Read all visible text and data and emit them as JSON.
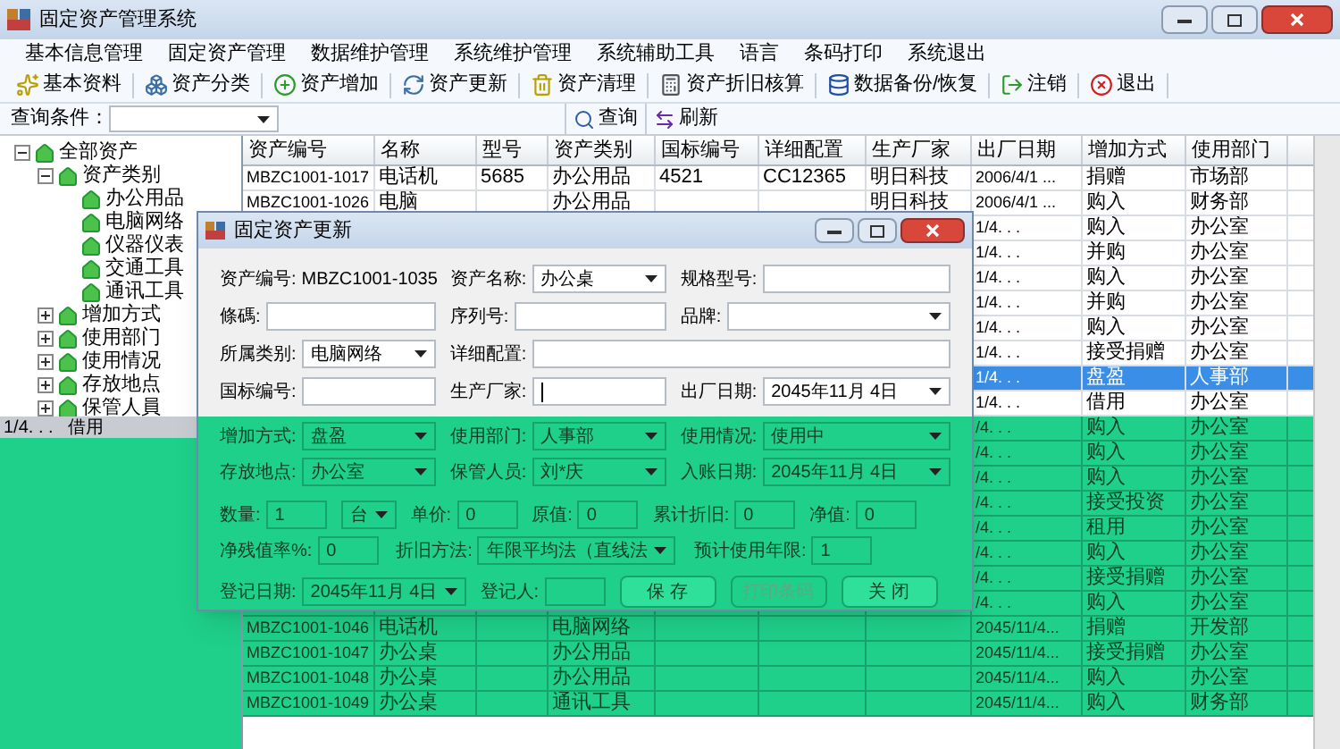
{
  "window": {
    "title": "固定资产管理系统"
  },
  "menu": [
    "基本信息管理",
    "固定资产管理",
    "数据维护管理",
    "系统维护管理",
    "系统辅助工具",
    "语言",
    "条码打印",
    "系统退出"
  ],
  "toolbar": [
    "基本资料",
    "资产分类",
    "资产增加",
    "资产更新",
    "资产清理",
    "资产折旧核算",
    "数据备份/恢复",
    "注销",
    "退出"
  ],
  "query": {
    "label": "查询条件：",
    "buttons": [
      "查询",
      "刷新"
    ]
  },
  "tree": [
    {
      "label": "全部资产",
      "expanded": true,
      "children": [
        {
          "label": "资产类别",
          "expanded": true,
          "children": [
            {
              "label": "办公用品"
            },
            {
              "label": "电脑网络"
            },
            {
              "label": "仪器仪表"
            },
            {
              "label": "交通工具"
            },
            {
              "label": "通讯工具"
            }
          ]
        },
        {
          "label": "增加方式",
          "expanded": false
        },
        {
          "label": "使用部门",
          "expanded": false
        },
        {
          "label": "使用情况",
          "expanded": false
        },
        {
          "label": "存放地点",
          "expanded": false
        },
        {
          "label": "保管人員",
          "expanded": false
        }
      ]
    }
  ],
  "glitch_strip": [
    "1/4. . .",
    "借用"
  ],
  "table": {
    "columns": [
      "资产编号",
      "名称",
      "型号",
      "资产类别",
      "国标编号",
      "详细配置",
      "生产厂家",
      "出厂日期",
      "增加方式",
      "使用部门"
    ],
    "rows": [
      {
        "selected": false,
        "cells": [
          "MBZC1001-1017",
          "电话机",
          "5685",
          "办公用品",
          "4521",
          "CC12365",
          "明日科技",
          "2006/4/1 ...",
          "捐赠",
          "市场部"
        ]
      },
      {
        "selected": false,
        "cells": [
          "MBZC1001-1026",
          "电脑",
          null,
          "办公用品",
          null,
          null,
          "明日科技",
          "2006/4/1 ...",
          "购入",
          "财务部"
        ]
      },
      {
        "selected": false,
        "cells": [
          null,
          null,
          null,
          null,
          null,
          null,
          null,
          "1/4. . .",
          "购入",
          "办公室"
        ]
      },
      {
        "selected": false,
        "cells": [
          null,
          null,
          null,
          null,
          null,
          null,
          null,
          "1/4. . .",
          "并购",
          "办公室"
        ]
      },
      {
        "selected": false,
        "cells": [
          null,
          null,
          null,
          null,
          null,
          null,
          null,
          "1/4. . .",
          "购入",
          "办公室"
        ]
      },
      {
        "selected": false,
        "cells": [
          null,
          null,
          null,
          null,
          null,
          null,
          null,
          "1/4. . .",
          "并购",
          "办公室"
        ]
      },
      {
        "selected": false,
        "cells": [
          null,
          null,
          null,
          null,
          null,
          null,
          null,
          "1/4. . .",
          "购入",
          "办公室"
        ]
      },
      {
        "selected": false,
        "cells": [
          null,
          null,
          null,
          null,
          null,
          null,
          null,
          "1/4. . .",
          "接受捐赠",
          "办公室"
        ]
      },
      {
        "selected": true,
        "cells": [
          null,
          null,
          null,
          null,
          null,
          null,
          null,
          "1/4. . .",
          "盘盈",
          "人事部"
        ]
      },
      {
        "selected": false,
        "cells": [
          null,
          null,
          null,
          null,
          null,
          null,
          null,
          "1/4. . .",
          "借用",
          "办公室"
        ]
      },
      {
        "selected": false,
        "cells": [
          null,
          null,
          null,
          null,
          null,
          null,
          null,
          "/4. . .",
          "购入",
          "办公室"
        ]
      },
      {
        "selected": false,
        "cells": [
          null,
          null,
          null,
          null,
          null,
          null,
          null,
          "/4. . .",
          "购入",
          "办公室"
        ]
      },
      {
        "selected": false,
        "cells": [
          null,
          null,
          null,
          null,
          null,
          null,
          null,
          "/4. . .",
          "购入",
          "办公室"
        ]
      },
      {
        "selected": false,
        "cells": [
          null,
          null,
          null,
          null,
          null,
          null,
          null,
          "/4. . .",
          "接受投资",
          "办公室"
        ]
      },
      {
        "selected": false,
        "cells": [
          null,
          null,
          null,
          null,
          null,
          null,
          null,
          "/4. . .",
          "租用",
          "办公室"
        ]
      },
      {
        "selected": false,
        "cells": [
          null,
          null,
          null,
          null,
          null,
          null,
          null,
          "/4. . .",
          "购入",
          "办公室"
        ]
      },
      {
        "selected": false,
        "cells": [
          null,
          null,
          null,
          null,
          null,
          null,
          null,
          "/4. . .",
          "接受捐赠",
          "办公室"
        ]
      },
      {
        "selected": false,
        "cells": [
          null,
          null,
          null,
          null,
          null,
          null,
          null,
          "/4. . .",
          "购入",
          "办公室"
        ]
      },
      {
        "selected": false,
        "cells": [
          "MBZC1001-1046",
          "电话机",
          null,
          "电脑网络",
          null,
          null,
          null,
          "2045/11/4...",
          "捐赠",
          "开发部"
        ]
      },
      {
        "selected": false,
        "cells": [
          "MBZC1001-1047",
          "办公桌",
          null,
          "办公用品",
          null,
          null,
          null,
          "2045/11/4...",
          "接受捐赠",
          "办公室"
        ]
      },
      {
        "selected": false,
        "cells": [
          "MBZC1001-1048",
          "办公桌",
          null,
          "办公用品",
          null,
          null,
          null,
          "2045/11/4...",
          "购入",
          "办公室"
        ]
      },
      {
        "selected": false,
        "cells": [
          "MBZC1001-1049",
          "办公桌",
          null,
          "通讯工具",
          null,
          null,
          null,
          "2045/11/4...",
          "购入",
          "财务部"
        ]
      }
    ]
  },
  "dialog": {
    "title": "固定资产更新",
    "rows": [
      [
        {
          "label": "资产编号:",
          "kind": "text",
          "value": "MBZC1001-1035"
        },
        {
          "label": "资产名称:",
          "kind": "combo",
          "value": "办公桌"
        },
        {
          "label": "规格型号:",
          "kind": "input"
        }
      ],
      [
        {
          "label": "條碼:",
          "kind": "input"
        },
        {
          "label": "序列号:",
          "kind": "input"
        },
        {
          "label": "品牌:",
          "kind": "combo"
        }
      ],
      [
        {
          "label": "所属类别:",
          "kind": "combo",
          "value": "电脑网络"
        },
        {
          "label": "详细配置:",
          "kind": "input"
        }
      ],
      [
        {
          "label": "国标编号:",
          "kind": "input"
        },
        {
          "label": "生产厂家:",
          "kind": "input",
          "focused": true
        },
        {
          "label": "出厂日期:",
          "kind": "combo",
          "value": "2045年11月 4日"
        }
      ],
      [
        {
          "label": "增加方式:",
          "kind": "combo",
          "value": "盘盈"
        },
        {
          "label": "使用部门:",
          "kind": "combo",
          "value": "人事部"
        },
        {
          "label": "使用情况:",
          "kind": "combo",
          "value": "使用中"
        }
      ],
      [
        {
          "label": "存放地点:",
          "kind": "combo",
          "value": "办公室"
        },
        {
          "label": "保管人员:",
          "kind": "combo",
          "value": "刘*庆"
        },
        {
          "label": "入账日期:",
          "kind": "combo",
          "value": "2045年11月 4日"
        }
      ]
    ],
    "amounts": [
      {
        "label": "数量:",
        "kind": "input",
        "value": "1"
      },
      {
        "kind": "combo",
        "value": "台"
      },
      {
        "label": "单价:",
        "kind": "input",
        "value": "0"
      },
      {
        "label": "原值:",
        "kind": "input",
        "value": "0"
      },
      {
        "label": "累计折旧:",
        "kind": "input",
        "value": "0"
      },
      {
        "label": "净值:",
        "kind": "input",
        "value": "0"
      }
    ],
    "depreciation": [
      {
        "label": "净残值率%:",
        "kind": "input",
        "value": "0"
      },
      {
        "label": "折旧方法:",
        "kind": "combo",
        "value": "年限平均法（直线法"
      },
      {
        "label": "预计使用年限:",
        "kind": "input",
        "value": "1"
      }
    ],
    "registration": [
      {
        "label": "登记日期:",
        "kind": "combo",
        "value": "2045年11月 4日"
      },
      {
        "label": "登记人:",
        "kind": "input"
      }
    ],
    "buttons": [
      {
        "label": "保 存",
        "disabled": false
      },
      {
        "label": "打印条码",
        "disabled": true
      },
      {
        "label": "关 闭",
        "disabled": false
      }
    ]
  }
}
